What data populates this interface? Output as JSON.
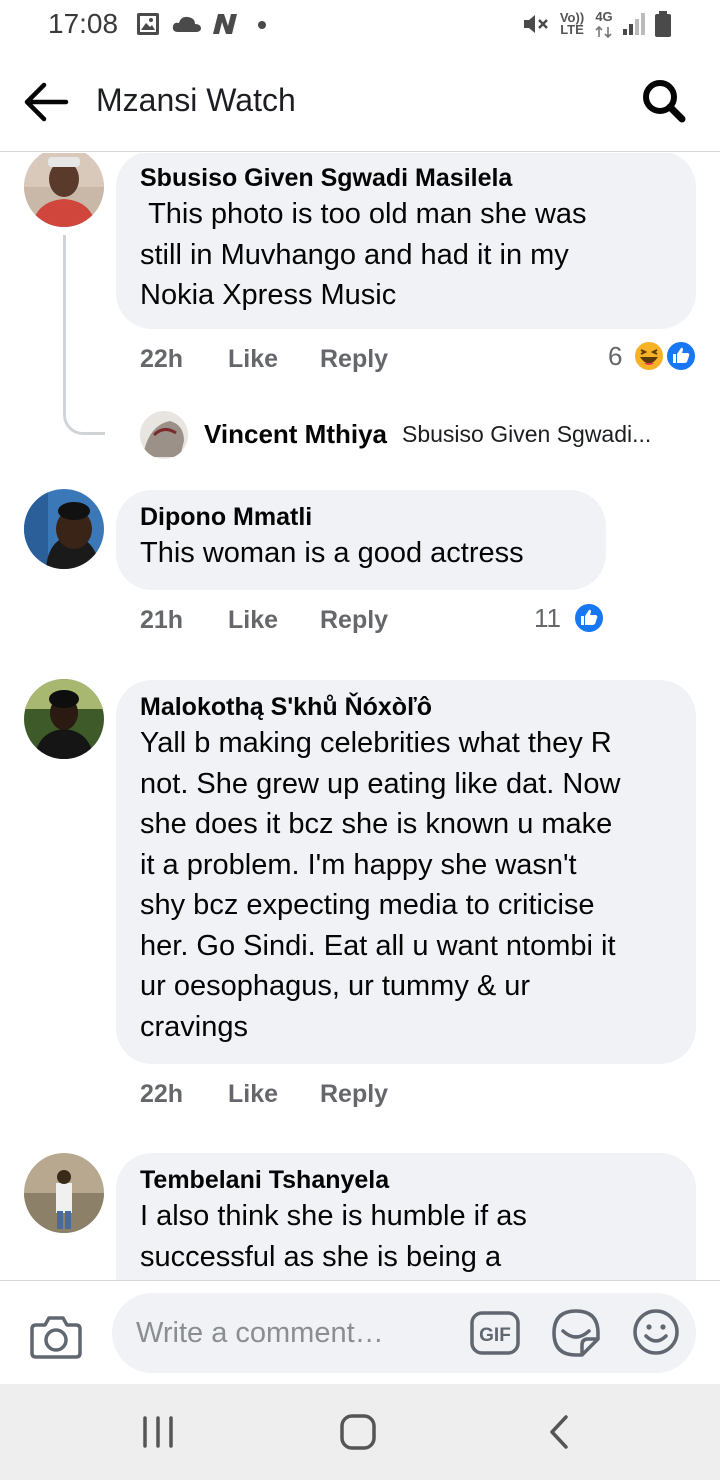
{
  "status_bar": {
    "time": "17:08",
    "left_icons": [
      "gallery-icon",
      "cloud-icon",
      "n-icon",
      "dot"
    ],
    "volte": "Vo))\nLTE",
    "network": "4G"
  },
  "header": {
    "title": "Mzansi Watch",
    "back_icon": "arrow-left-icon",
    "search_icon": "search-icon"
  },
  "comments": [
    {
      "author": "Sbusiso Given Sgwadi Masilela",
      "text": " This photo is too old man she was\nstill in Muvhango and had it in my\nNokia Xpress Music",
      "time": "22h",
      "like": "Like",
      "reply": "Reply",
      "reaction_count": "6",
      "reaction_icons": [
        "haha-icon",
        "like-icon"
      ]
    },
    {
      "author": "Dipono Mmatli",
      "text": "This woman is a good actress",
      "time": "21h",
      "like": "Like",
      "reply": "Reply",
      "reaction_count": "11",
      "reaction_icons": [
        "like-icon"
      ]
    },
    {
      "author": "Malokothą S'khů Ňóxòľô",
      "text": "Yall b making celebrities what they R\nnot. She grew up eating like dat. Now\nshe does it bcz she is known u make\nit a problem. I'm happy she wasn't\nshy bcz expecting media to criticise\nher. Go Sindi. Eat all u want ntombi it\nur oesophagus, ur tummy & ur\ncravings",
      "time": "22h",
      "like": "Like",
      "reply": "Reply"
    },
    {
      "author": "Tembelani Tshanyela",
      "text": "I also think she is humble if as\nsuccessful as she is being a"
    }
  ],
  "reply_preview": {
    "author": "Vincent Mthiya",
    "snippet": "Sbusiso Given Sgwadi..."
  },
  "composer": {
    "placeholder": "Write a comment…",
    "gif_label": "GIF"
  },
  "navbar": {
    "icons": [
      "recent-apps-icon",
      "home-icon",
      "back-icon"
    ]
  },
  "colors": {
    "accent": "#1877f2",
    "bubble": "#f0f2f5",
    "meta": "#65676b"
  }
}
